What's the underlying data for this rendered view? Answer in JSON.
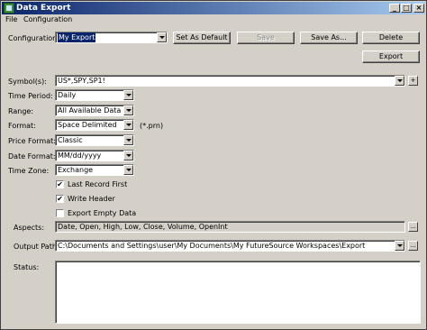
{
  "window": {
    "title": "Data Export",
    "controls": {
      "minimize": "_",
      "maximize": "□",
      "close": "×"
    }
  },
  "menu": {
    "items": [
      "File",
      "Configuration"
    ]
  },
  "configuration": {
    "label": "Configuration:",
    "value": "My Export",
    "buttons": {
      "set_default": "Set As Default",
      "save": "Save",
      "save_as": "Save As...",
      "delete": "Delete",
      "export": "Export"
    }
  },
  "symbols": {
    "label": "Symbol(s):",
    "value": "US*,SPY,SP1!",
    "add_label": "+"
  },
  "time_period": {
    "label": "Time Period:",
    "value": "Daily"
  },
  "range": {
    "label": "Range:",
    "value": "All Available Data"
  },
  "format": {
    "label": "Format:",
    "value": "Space Delimited",
    "extension": "(*.prn)"
  },
  "price_format": {
    "label": "Price Format:",
    "value": "Classic"
  },
  "date_format": {
    "label": "Date Format:",
    "value": "MM/dd/yyyy"
  },
  "time_zone": {
    "label": "Time Zone:",
    "value": "Exchange"
  },
  "options": {
    "last_record_first": {
      "label": "Last Record First",
      "checked": true,
      "mark": "✔"
    },
    "write_header": {
      "label": "Write Header",
      "checked": true,
      "mark": "✔"
    },
    "export_empty_data": {
      "label": "Export Empty Data",
      "checked": false,
      "mark": ""
    }
  },
  "aspects": {
    "label": "Aspects:",
    "value": "Date, Open, High, Low, Close, Volume, OpenInt",
    "browse": "..."
  },
  "output_path": {
    "label": "Output Path:",
    "value": "C:\\Documents and Settings\\user\\My Documents\\My FutureSource Workspaces\\Export",
    "browse": "..."
  },
  "status": {
    "label": "Status:"
  }
}
